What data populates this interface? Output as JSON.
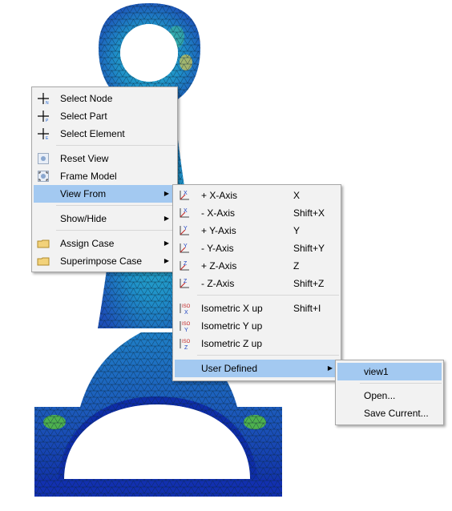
{
  "context_menu": {
    "items": [
      {
        "label": "Select Node",
        "icon": "select-node-icon"
      },
      {
        "label": "Select Part",
        "icon": "select-part-icon"
      },
      {
        "label": "Select Element",
        "icon": "select-element-icon"
      },
      {
        "label": "Reset View",
        "icon": "reset-view-icon"
      },
      {
        "label": "Frame Model",
        "icon": "frame-model-icon"
      },
      {
        "label": "View From",
        "icon": "",
        "submenu": true,
        "highlighted": true
      },
      {
        "label": "Show/Hide",
        "icon": "",
        "submenu": true
      },
      {
        "label": "Assign Case",
        "icon": "folder-icon",
        "submenu": true
      },
      {
        "label": "Superimpose Case",
        "icon": "folder-icon",
        "submenu": true
      }
    ]
  },
  "view_from_menu": {
    "items": [
      {
        "label": "+ X-Axis",
        "shortcut": "X",
        "icon": "plus-x-axis-icon"
      },
      {
        "label": "- X-Axis",
        "shortcut": "Shift+X",
        "icon": "minus-x-axis-icon"
      },
      {
        "label": "+ Y-Axis",
        "shortcut": "Y",
        "icon": "plus-y-axis-icon"
      },
      {
        "label": "- Y-Axis",
        "shortcut": "Shift+Y",
        "icon": "minus-y-axis-icon"
      },
      {
        "label": "+ Z-Axis",
        "shortcut": "Z",
        "icon": "plus-z-axis-icon"
      },
      {
        "label": "- Z-Axis",
        "shortcut": "Shift+Z",
        "icon": "minus-z-axis-icon"
      },
      {
        "label": "Isometric X up",
        "shortcut": "Shift+I",
        "icon": "iso-x-icon"
      },
      {
        "label": "Isometric Y up",
        "shortcut": "",
        "icon": "iso-y-icon"
      },
      {
        "label": "Isometric Z up",
        "shortcut": "",
        "icon": "iso-z-icon"
      },
      {
        "label": "User Defined",
        "shortcut": "",
        "submenu": true,
        "highlighted": true
      }
    ]
  },
  "user_defined_menu": {
    "items": [
      {
        "label": "view1",
        "highlighted": true
      },
      {
        "label": "Open..."
      },
      {
        "label": "Save Current..."
      }
    ]
  },
  "colors": {
    "menu_bg": "#f2f2f2",
    "highlight": "#a3c9f1",
    "mesh_blue": "#1f5fbf",
    "mesh_dark_blue": "#0a2aa8",
    "mesh_cyan": "#2ab6c8",
    "mesh_green": "#57c23c"
  }
}
